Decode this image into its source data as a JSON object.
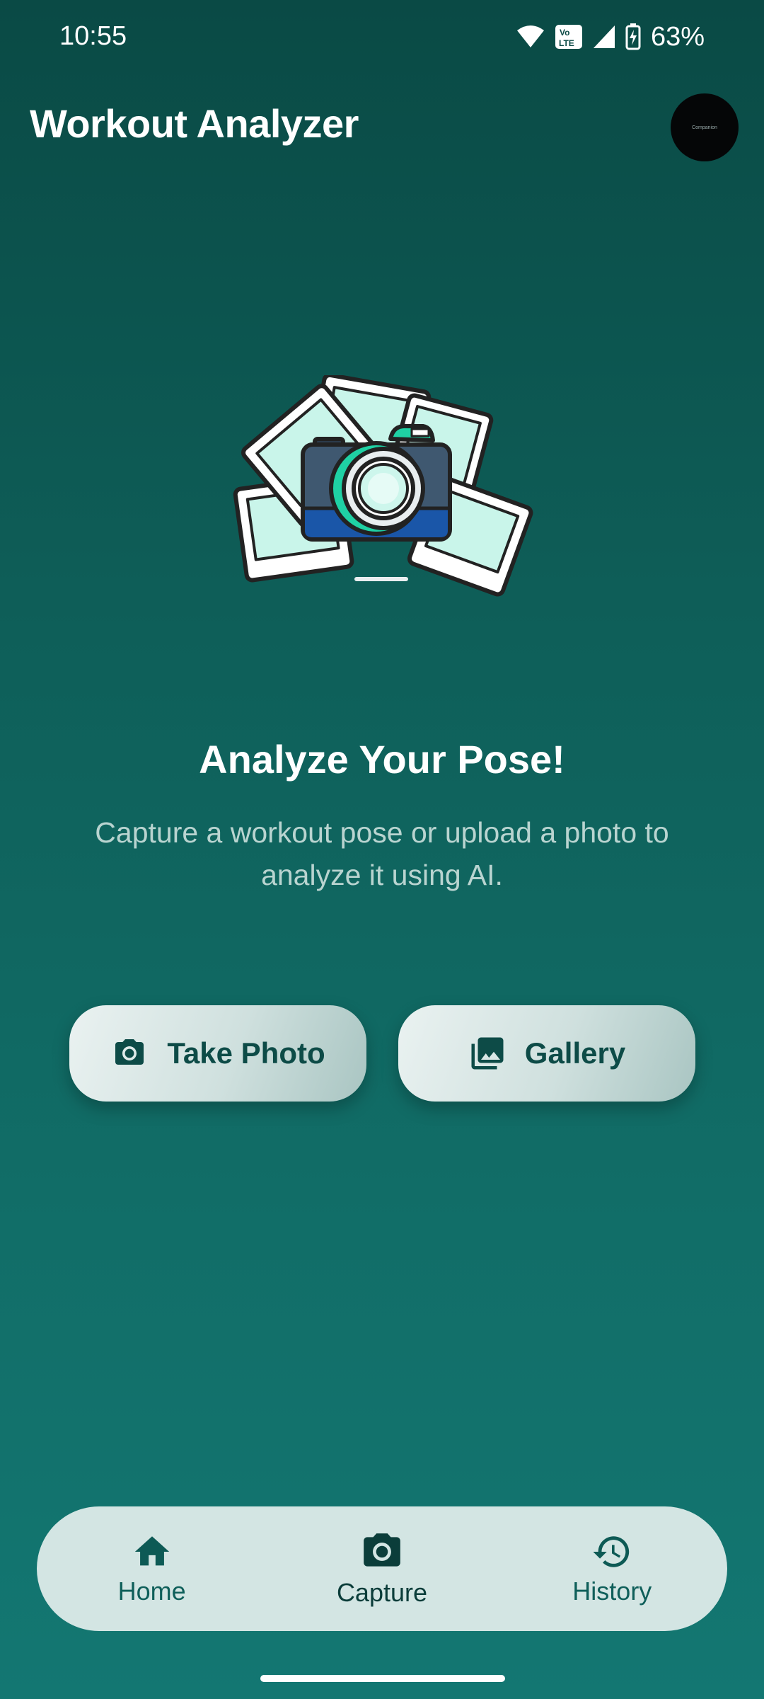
{
  "status_bar": {
    "time": "10:55",
    "battery": "63%",
    "network_badge": "Vo LTE"
  },
  "app_bar": {
    "title": "Workout Analyzer",
    "avatar_text": "Companion"
  },
  "hero": {
    "headline": "Analyze Your Pose!",
    "description": "Capture a workout pose or upload a photo to analyze it using AI."
  },
  "actions": {
    "take_photo": {
      "label": "Take Photo",
      "icon": "camera-icon"
    },
    "gallery": {
      "label": "Gallery",
      "icon": "photo-library-icon"
    }
  },
  "bottom_nav": {
    "items": [
      {
        "label": "Home",
        "icon": "home-icon"
      },
      {
        "label": "Capture",
        "icon": "camera-icon",
        "active": true
      },
      {
        "label": "History",
        "icon": "history-icon"
      }
    ]
  },
  "colors": {
    "background": "#0e5e58",
    "accent": "#0d4b47",
    "nav_bg": "#d3e5e3"
  }
}
